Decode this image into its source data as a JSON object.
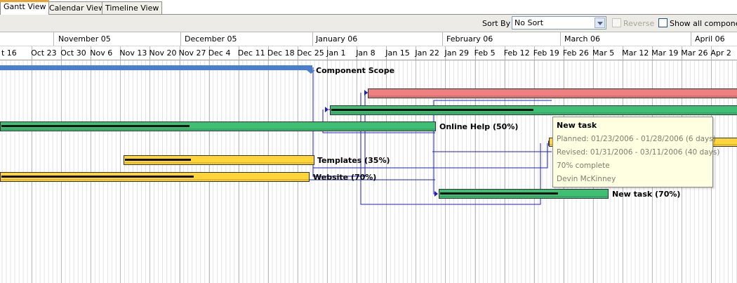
{
  "tabs": [
    {
      "label": "Gantt View",
      "active": true
    },
    {
      "label": "Calendar View",
      "active": false
    },
    {
      "label": "Timeline View",
      "active": false
    }
  ],
  "toolbar": {
    "sort_by_label": "Sort By",
    "sort_value": "No Sort",
    "reverse_label": "Reverse",
    "show_all_label": "Show all components"
  },
  "timescale": {
    "months": [
      "November 05",
      "December 05",
      "January 06",
      "February 06",
      "March 06",
      "April 06"
    ],
    "weeks": [
      "t 16",
      "Oct 23",
      "Oct 30",
      "Nov 6",
      "Nov 13",
      "Nov 20",
      "Nov 27",
      "Dec 4",
      "Dec 11",
      "Dec 18",
      "Dec 25",
      "Jan 1",
      "Jan 8",
      "Jan 15",
      "Jan 22",
      "Jan 29",
      "Feb 5",
      "Feb 12",
      "Feb 19",
      "Feb 26",
      "Mar 5",
      "Mar 12",
      "Mar 19",
      "Mar 26",
      "Apr 2",
      "Apr"
    ]
  },
  "tasks": {
    "component_scope": "Component Scope",
    "online_help": "Online Help (50%)",
    "templates": "Templates (35%)",
    "website": "Website (70%)",
    "new_task": "New task (70%)"
  },
  "tooltip": {
    "title": "New task",
    "planned": "Planned: 01/23/2006 - 01/28/2006 (6 days)",
    "revised": "Revised: 01/31/2006 - 03/11/2006 (40 days)",
    "complete": "70% complete",
    "owner": "Devin McKinney"
  },
  "colors": {
    "scope": "#4a7ed0",
    "green": "#3fbf74",
    "yellow": "#ffd53a",
    "red": "#f07f7f",
    "link": "#1e1ec8",
    "tooltip_bg": "#ffffe1"
  }
}
